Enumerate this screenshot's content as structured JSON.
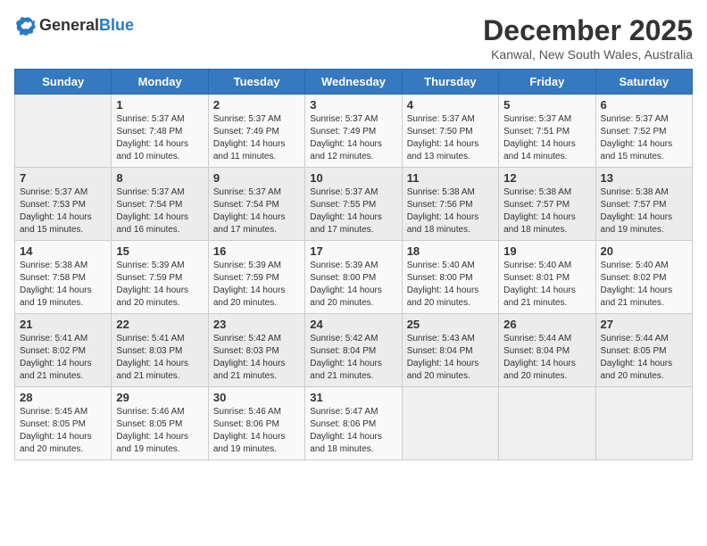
{
  "header": {
    "logo_general": "General",
    "logo_blue": "Blue",
    "month": "December 2025",
    "location": "Kanwal, New South Wales, Australia"
  },
  "days_of_week": [
    "Sunday",
    "Monday",
    "Tuesday",
    "Wednesday",
    "Thursday",
    "Friday",
    "Saturday"
  ],
  "weeks": [
    [
      {
        "day": "",
        "sunrise": "",
        "sunset": "",
        "daylight": ""
      },
      {
        "day": "1",
        "sunrise": "Sunrise: 5:37 AM",
        "sunset": "Sunset: 7:48 PM",
        "daylight": "Daylight: 14 hours and 10 minutes."
      },
      {
        "day": "2",
        "sunrise": "Sunrise: 5:37 AM",
        "sunset": "Sunset: 7:49 PM",
        "daylight": "Daylight: 14 hours and 11 minutes."
      },
      {
        "day": "3",
        "sunrise": "Sunrise: 5:37 AM",
        "sunset": "Sunset: 7:49 PM",
        "daylight": "Daylight: 14 hours and 12 minutes."
      },
      {
        "day": "4",
        "sunrise": "Sunrise: 5:37 AM",
        "sunset": "Sunset: 7:50 PM",
        "daylight": "Daylight: 14 hours and 13 minutes."
      },
      {
        "day": "5",
        "sunrise": "Sunrise: 5:37 AM",
        "sunset": "Sunset: 7:51 PM",
        "daylight": "Daylight: 14 hours and 14 minutes."
      },
      {
        "day": "6",
        "sunrise": "Sunrise: 5:37 AM",
        "sunset": "Sunset: 7:52 PM",
        "daylight": "Daylight: 14 hours and 15 minutes."
      }
    ],
    [
      {
        "day": "7",
        "sunrise": "Sunrise: 5:37 AM",
        "sunset": "Sunset: 7:53 PM",
        "daylight": "Daylight: 14 hours and 15 minutes."
      },
      {
        "day": "8",
        "sunrise": "Sunrise: 5:37 AM",
        "sunset": "Sunset: 7:54 PM",
        "daylight": "Daylight: 14 hours and 16 minutes."
      },
      {
        "day": "9",
        "sunrise": "Sunrise: 5:37 AM",
        "sunset": "Sunset: 7:54 PM",
        "daylight": "Daylight: 14 hours and 17 minutes."
      },
      {
        "day": "10",
        "sunrise": "Sunrise: 5:37 AM",
        "sunset": "Sunset: 7:55 PM",
        "daylight": "Daylight: 14 hours and 17 minutes."
      },
      {
        "day": "11",
        "sunrise": "Sunrise: 5:38 AM",
        "sunset": "Sunset: 7:56 PM",
        "daylight": "Daylight: 14 hours and 18 minutes."
      },
      {
        "day": "12",
        "sunrise": "Sunrise: 5:38 AM",
        "sunset": "Sunset: 7:57 PM",
        "daylight": "Daylight: 14 hours and 18 minutes."
      },
      {
        "day": "13",
        "sunrise": "Sunrise: 5:38 AM",
        "sunset": "Sunset: 7:57 PM",
        "daylight": "Daylight: 14 hours and 19 minutes."
      }
    ],
    [
      {
        "day": "14",
        "sunrise": "Sunrise: 5:38 AM",
        "sunset": "Sunset: 7:58 PM",
        "daylight": "Daylight: 14 hours and 19 minutes."
      },
      {
        "day": "15",
        "sunrise": "Sunrise: 5:39 AM",
        "sunset": "Sunset: 7:59 PM",
        "daylight": "Daylight: 14 hours and 20 minutes."
      },
      {
        "day": "16",
        "sunrise": "Sunrise: 5:39 AM",
        "sunset": "Sunset: 7:59 PM",
        "daylight": "Daylight: 14 hours and 20 minutes."
      },
      {
        "day": "17",
        "sunrise": "Sunrise: 5:39 AM",
        "sunset": "Sunset: 8:00 PM",
        "daylight": "Daylight: 14 hours and 20 minutes."
      },
      {
        "day": "18",
        "sunrise": "Sunrise: 5:40 AM",
        "sunset": "Sunset: 8:00 PM",
        "daylight": "Daylight: 14 hours and 20 minutes."
      },
      {
        "day": "19",
        "sunrise": "Sunrise: 5:40 AM",
        "sunset": "Sunset: 8:01 PM",
        "daylight": "Daylight: 14 hours and 21 minutes."
      },
      {
        "day": "20",
        "sunrise": "Sunrise: 5:40 AM",
        "sunset": "Sunset: 8:02 PM",
        "daylight": "Daylight: 14 hours and 21 minutes."
      }
    ],
    [
      {
        "day": "21",
        "sunrise": "Sunrise: 5:41 AM",
        "sunset": "Sunset: 8:02 PM",
        "daylight": "Daylight: 14 hours and 21 minutes."
      },
      {
        "day": "22",
        "sunrise": "Sunrise: 5:41 AM",
        "sunset": "Sunset: 8:03 PM",
        "daylight": "Daylight: 14 hours and 21 minutes."
      },
      {
        "day": "23",
        "sunrise": "Sunrise: 5:42 AM",
        "sunset": "Sunset: 8:03 PM",
        "daylight": "Daylight: 14 hours and 21 minutes."
      },
      {
        "day": "24",
        "sunrise": "Sunrise: 5:42 AM",
        "sunset": "Sunset: 8:04 PM",
        "daylight": "Daylight: 14 hours and 21 minutes."
      },
      {
        "day": "25",
        "sunrise": "Sunrise: 5:43 AM",
        "sunset": "Sunset: 8:04 PM",
        "daylight": "Daylight: 14 hours and 20 minutes."
      },
      {
        "day": "26",
        "sunrise": "Sunrise: 5:44 AM",
        "sunset": "Sunset: 8:04 PM",
        "daylight": "Daylight: 14 hours and 20 minutes."
      },
      {
        "day": "27",
        "sunrise": "Sunrise: 5:44 AM",
        "sunset": "Sunset: 8:05 PM",
        "daylight": "Daylight: 14 hours and 20 minutes."
      }
    ],
    [
      {
        "day": "28",
        "sunrise": "Sunrise: 5:45 AM",
        "sunset": "Sunset: 8:05 PM",
        "daylight": "Daylight: 14 hours and 20 minutes."
      },
      {
        "day": "29",
        "sunrise": "Sunrise: 5:46 AM",
        "sunset": "Sunset: 8:05 PM",
        "daylight": "Daylight: 14 hours and 19 minutes."
      },
      {
        "day": "30",
        "sunrise": "Sunrise: 5:46 AM",
        "sunset": "Sunset: 8:06 PM",
        "daylight": "Daylight: 14 hours and 19 minutes."
      },
      {
        "day": "31",
        "sunrise": "Sunrise: 5:47 AM",
        "sunset": "Sunset: 8:06 PM",
        "daylight": "Daylight: 14 hours and 18 minutes."
      },
      {
        "day": "",
        "sunrise": "",
        "sunset": "",
        "daylight": ""
      },
      {
        "day": "",
        "sunrise": "",
        "sunset": "",
        "daylight": ""
      },
      {
        "day": "",
        "sunrise": "",
        "sunset": "",
        "daylight": ""
      }
    ]
  ]
}
